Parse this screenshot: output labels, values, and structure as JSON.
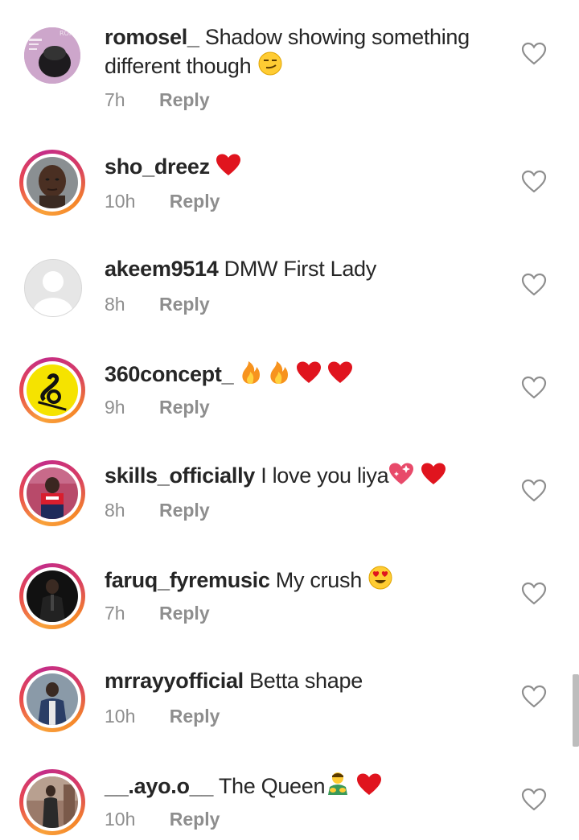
{
  "comments": [
    {
      "username": "romosel_",
      "text": "Shadow showing something",
      "text_line2": "different though",
      "emoji": [
        "smirk-emoji"
      ],
      "time": "7h",
      "reply_label": "Reply",
      "story_ring": false,
      "avatar_text": "ROMS"
    },
    {
      "username": "sho_dreez",
      "text": "",
      "emoji": [
        "red-heart-emoji"
      ],
      "time": "10h",
      "reply_label": "Reply",
      "story_ring": true
    },
    {
      "username": "akeem9514",
      "text": "DMW First Lady",
      "emoji": [],
      "time": "8h",
      "reply_label": "Reply",
      "story_ring": false
    },
    {
      "username": "360concept_",
      "text": "",
      "emoji": [
        "fire-emoji",
        "fire-emoji",
        "red-heart-emoji",
        "red-heart-emoji"
      ],
      "time": "9h",
      "reply_label": "Reply",
      "story_ring": true
    },
    {
      "username": "skills_officially",
      "text": "I love you liya",
      "emoji": [
        "sparkling-heart-emoji",
        "red-heart-emoji"
      ],
      "time": "8h",
      "reply_label": "Reply",
      "story_ring": true
    },
    {
      "username": "faruq_fyremusic",
      "text": "My crush",
      "emoji": [
        "heart-eyes-emoji"
      ],
      "time": "7h",
      "reply_label": "Reply",
      "story_ring": true
    },
    {
      "username": "mrrayyofficial",
      "text": "Betta shape",
      "emoji": [],
      "time": "10h",
      "reply_label": "Reply",
      "story_ring": true
    },
    {
      "username": "__.ayo.o__",
      "text": "The Queen",
      "emoji": [
        "man-bowing-emoji",
        "red-heart-emoji"
      ],
      "time": "10h",
      "reply_label": "Reply",
      "story_ring": true
    }
  ],
  "colors": {
    "text": "#262626",
    "secondary": "#8e8e8e",
    "heart_red": "#e0141e",
    "fire_orange": "#f7931e",
    "ring_start": "#f9a13a",
    "ring_end": "#c42d88"
  },
  "icons": {
    "like": "heart-outline-icon"
  }
}
